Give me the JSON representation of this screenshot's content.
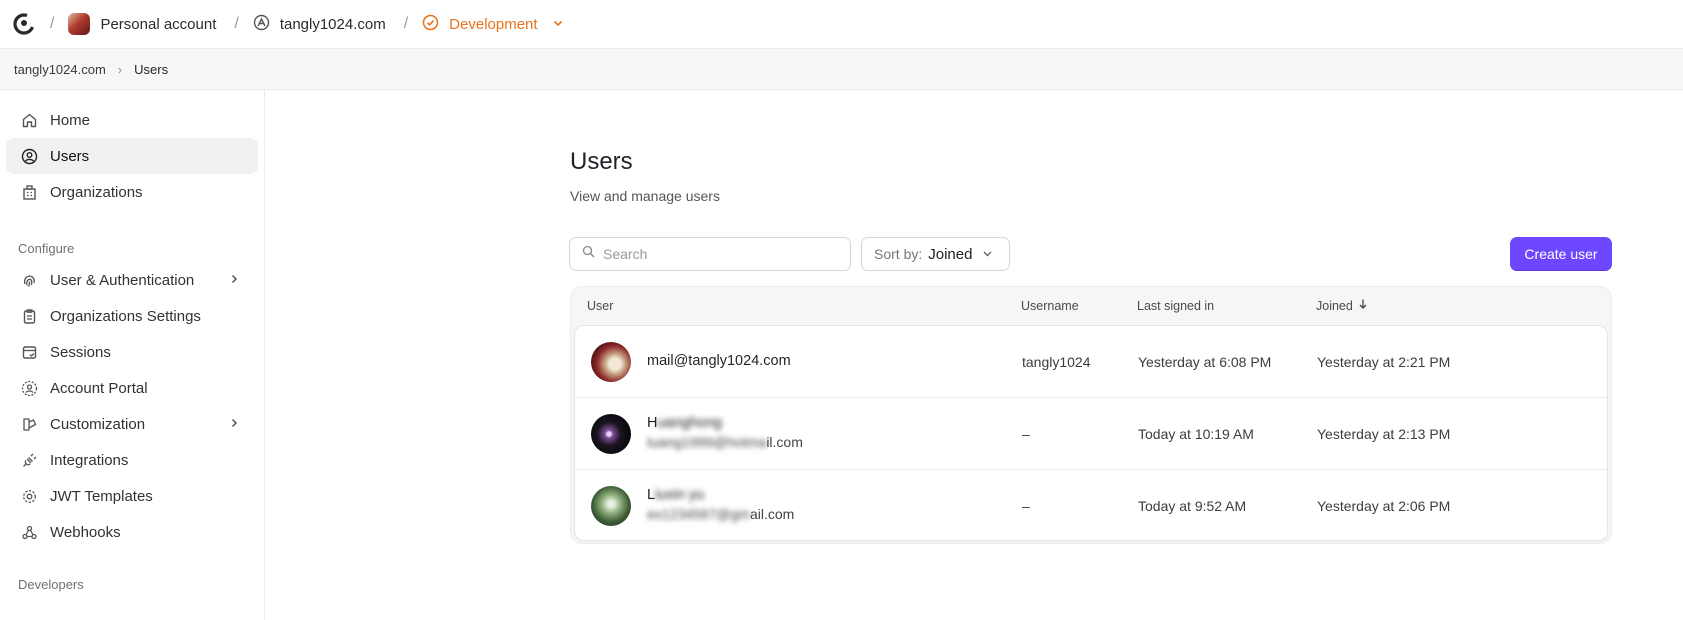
{
  "topbar": {
    "account": "Personal account",
    "app": "tangly1024.com",
    "environment": "Development",
    "env_color": "#e8731b"
  },
  "breadcrumb": {
    "root": "tangly1024.com",
    "current": "Users"
  },
  "sidebar": {
    "items": [
      {
        "label": "Home",
        "icon": "home-icon"
      },
      {
        "label": "Users",
        "icon": "user-circle-icon",
        "active": true
      },
      {
        "label": "Organizations",
        "icon": "building-icon"
      }
    ],
    "configure_label": "Configure",
    "configure_items": [
      {
        "label": "User & Authentication",
        "icon": "fingerprint-icon",
        "expandable": true
      },
      {
        "label": "Organizations Settings",
        "icon": "clipboard-icon"
      },
      {
        "label": "Sessions",
        "icon": "session-icon"
      },
      {
        "label": "Account Portal",
        "icon": "portal-icon"
      },
      {
        "label": "Customization",
        "icon": "brush-icon",
        "expandable": true
      },
      {
        "label": "Integrations",
        "icon": "plug-icon"
      },
      {
        "label": "JWT Templates",
        "icon": "gear-icon"
      },
      {
        "label": "Webhooks",
        "icon": "webhook-icon"
      }
    ],
    "developers_label": "Developers"
  },
  "main": {
    "title": "Users",
    "subtitle": "View and manage users",
    "search_placeholder": "Search",
    "sort_label": "Sort by:",
    "sort_value": "Joined",
    "create_button": "Create user",
    "accent_color": "#6c47ff"
  },
  "table": {
    "headers": {
      "user": "User",
      "username": "Username",
      "last_signed_in": "Last signed in",
      "joined": "Joined"
    },
    "rows": [
      {
        "name": "mail@tangly1024.com",
        "email": "",
        "username": "tangly1024",
        "last_signed_in": "Yesterday at 6:08 PM",
        "joined": "Yesterday at 2:21 PM"
      },
      {
        "name": "H",
        "name_blurred": "uanghong",
        "email": "",
        "email_blurred": "tuang1999@hotma",
        "email_tail": "il.com",
        "username": "–",
        "last_signed_in": "Today at 10:19 AM",
        "joined": "Yesterday at 2:13 PM"
      },
      {
        "name": "L",
        "name_blurred": "iuxin yu",
        "email": "",
        "email_blurred": "ex1234567@gm",
        "email_tail": "ail.com",
        "username": "–",
        "last_signed_in": "Today at 9:52 AM",
        "joined": "Yesterday at 2:06 PM"
      }
    ]
  }
}
